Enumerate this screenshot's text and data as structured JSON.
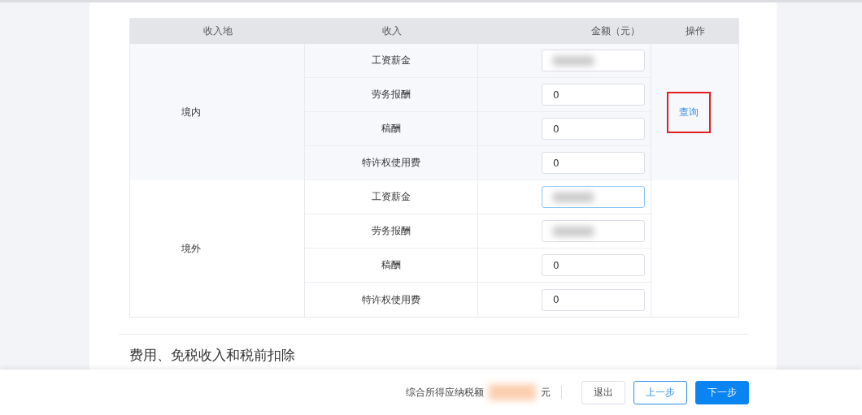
{
  "table": {
    "columns": [
      "收入地",
      "收入",
      "金额（元）",
      "操作"
    ],
    "groups": [
      {
        "region": "境内",
        "action": {
          "label": "查询",
          "highlighted": true
        },
        "rows": [
          {
            "income": "工资薪金",
            "amount": {
              "redacted": true,
              "focused": false
            }
          },
          {
            "income": "劳务报酬",
            "amount": {
              "value": "0",
              "focused": false
            }
          },
          {
            "income": "稿酬",
            "amount": {
              "value": "0",
              "focused": false
            }
          },
          {
            "income": "特许权使用费",
            "amount": {
              "value": "0",
              "focused": false
            }
          }
        ]
      },
      {
        "region": "境外",
        "rows": [
          {
            "income": "工资薪金",
            "amount": {
              "redacted": true,
              "focused": true
            }
          },
          {
            "income": "劳务报酬",
            "amount": {
              "redacted": true,
              "focused": false
            }
          },
          {
            "income": "稿酬",
            "amount": {
              "value": "0",
              "focused": false
            }
          },
          {
            "income": "特许权使用费",
            "amount": {
              "value": "0",
              "focused": false
            }
          }
        ]
      }
    ]
  },
  "next_section": {
    "title": "费用、免税收入和税前扣除"
  },
  "footer": {
    "tax_label": "综合所得应纳税额",
    "tax_amount": {
      "redacted": true
    },
    "unit": "元",
    "buttons": [
      {
        "label": "退出",
        "kind": "plain"
      },
      {
        "label": "上一步",
        "kind": "outline"
      },
      {
        "label": "下一步",
        "kind": "primary"
      }
    ]
  }
}
